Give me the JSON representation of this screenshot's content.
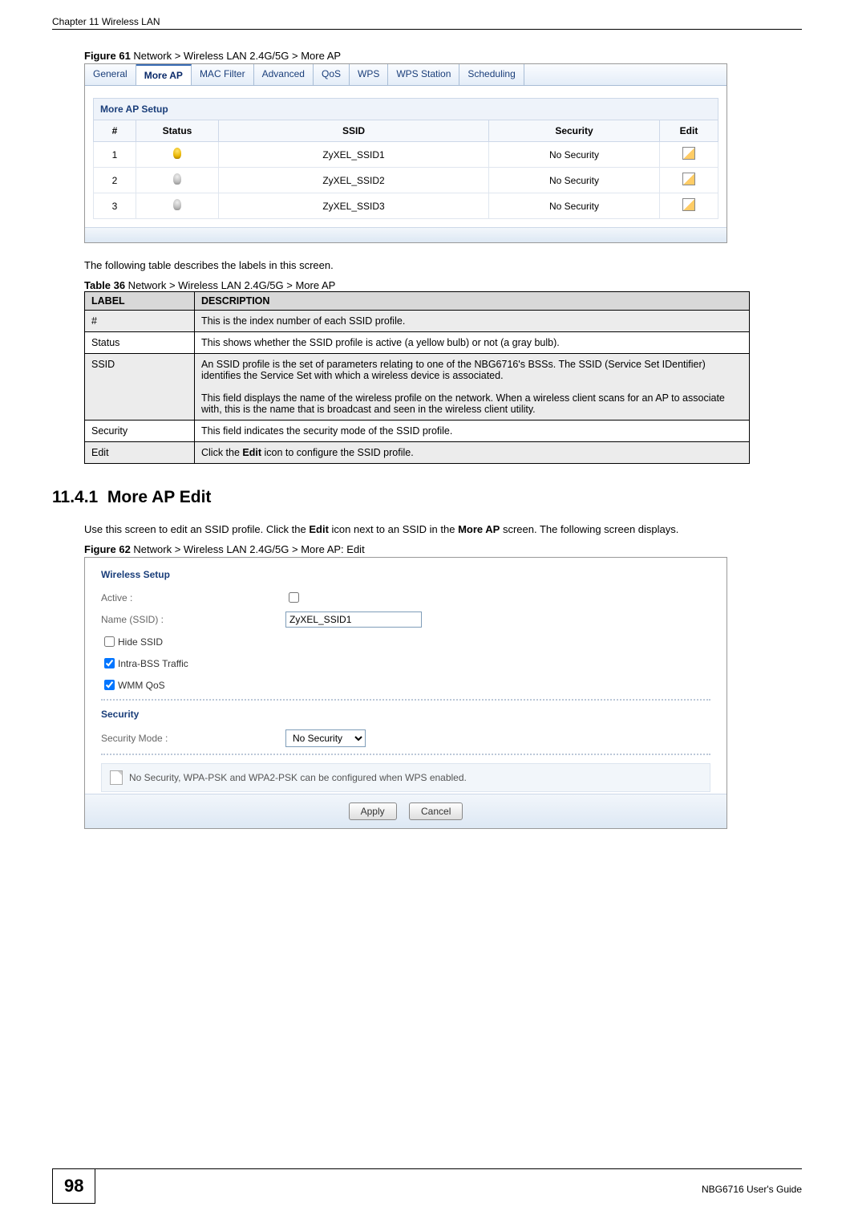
{
  "header": {
    "chapter": "Chapter 11 Wireless LAN"
  },
  "figure61": {
    "caption_bold": "Figure 61",
    "caption_rest": "   Network > Wireless LAN 2.4G/5G > More AP"
  },
  "tabs": [
    "General",
    "More AP",
    "MAC Filter",
    "Advanced",
    "QoS",
    "WPS",
    "WPS Station",
    "Scheduling"
  ],
  "more_ap_panel": {
    "title": "More AP Setup",
    "headers": {
      "num": "#",
      "status": "Status",
      "ssid": "SSID",
      "security": "Security",
      "edit": "Edit"
    },
    "rows": [
      {
        "num": "1",
        "status": "on",
        "ssid": "ZyXEL_SSID1",
        "security": "No Security"
      },
      {
        "num": "2",
        "status": "off",
        "ssid": "ZyXEL_SSID2",
        "security": "No Security"
      },
      {
        "num": "3",
        "status": "off",
        "ssid": "ZyXEL_SSID3",
        "security": "No Security"
      }
    ]
  },
  "para1": "The following table describes the labels in this screen.",
  "table36": {
    "caption_bold": "Table 36",
    "caption_rest": "   Network > Wireless LAN 2.4G/5G > More AP",
    "head_label": "LABEL",
    "head_desc": "DESCRIPTION",
    "rows": [
      {
        "label": "#",
        "desc": "This is the index number of each SSID profile."
      },
      {
        "label": "Status",
        "desc": "This shows whether the SSID profile is active (a yellow bulb) or not (a gray bulb)."
      },
      {
        "label": "SSID",
        "desc": "An SSID profile is the set of parameters relating to one of the NBG6716's BSSs. The SSID (Service Set IDentifier) identifies the Service Set with which a wireless device is associated.\n\nThis field displays the name of the wireless profile on the network. When a wireless client scans for an AP to associate with, this is the name that is broadcast and seen in the wireless client utility."
      },
      {
        "label": "Security",
        "desc": "This field indicates the security mode of the SSID profile."
      },
      {
        "label": "Edit",
        "desc_pre": "Click the ",
        "desc_bold": "Edit",
        "desc_post": " icon to configure the SSID profile."
      }
    ]
  },
  "heading": {
    "num": "11.4.1",
    "title": "More AP Edit"
  },
  "para2_pre": "Use this screen to edit an SSID profile. Click the ",
  "para2_b1": "Edit",
  "para2_mid": " icon next to an SSID in the ",
  "para2_b2": "More AP",
  "para2_post": " screen. The following screen displays.",
  "figure62": {
    "caption_bold": "Figure 62",
    "caption_rest": "   Network > Wireless LAN 2.4G/5G > More AP: Edit"
  },
  "wireless_setup": {
    "title": "Wireless Setup",
    "active_label": "Active :",
    "name_label": "Name (SSID) :",
    "name_value": "ZyXEL_SSID1",
    "hide_ssid": "Hide SSID",
    "intra_bss": "Intra-BSS Traffic",
    "wmm": "WMM QoS",
    "security_title": "Security",
    "sec_mode_label": "Security Mode :",
    "sec_mode_value": "No Security",
    "note": "No Security, WPA-PSK and WPA2-PSK can be configured when WPS enabled.",
    "apply": "Apply",
    "cancel": "Cancel"
  },
  "footer": {
    "page": "98",
    "guide": "NBG6716 User's Guide"
  }
}
